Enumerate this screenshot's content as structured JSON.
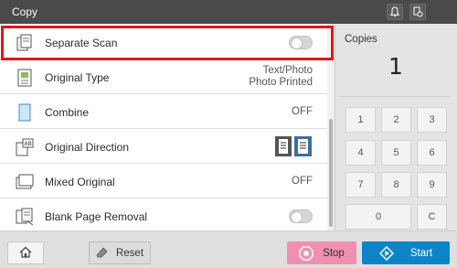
{
  "header": {
    "title": "Copy"
  },
  "settings": [
    {
      "label": "Separate Scan"
    },
    {
      "label": "Original Type",
      "value_line1": "Text/Photo",
      "value_line2": "Photo Printed"
    },
    {
      "label": "Combine",
      "value": "OFF"
    },
    {
      "label": "Original Direction"
    },
    {
      "label": "Mixed Original",
      "value": "OFF"
    },
    {
      "label": "Blank Page Removal"
    }
  ],
  "copies": {
    "label": "Copies",
    "value": "1"
  },
  "keypad": [
    "1",
    "2",
    "3",
    "4",
    "5",
    "6",
    "7",
    "8",
    "9",
    "0",
    "C"
  ],
  "footer": {
    "reset_label": "Reset",
    "stop_label": "Stop",
    "start_label": "Start"
  },
  "colors": {
    "highlight": "#e3141b",
    "stop": "#f090b0",
    "start": "#0e84c8"
  }
}
